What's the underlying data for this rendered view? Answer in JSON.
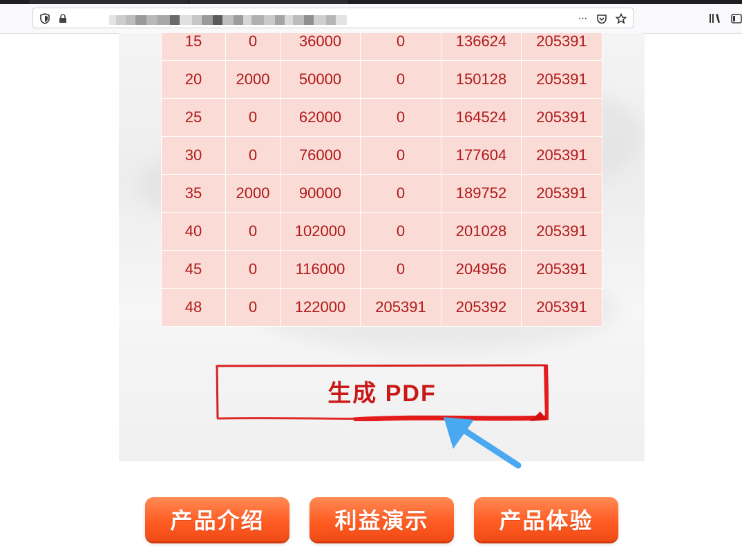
{
  "browser": {
    "url_obscured": true,
    "icons": [
      "shield-icon",
      "lock-icon",
      "more-icon",
      "pocket-icon",
      "star-icon",
      "library-icon",
      "sidebar-icon"
    ],
    "more_glyph": "···"
  },
  "table": {
    "rows": [
      [
        "15",
        "0",
        "36000",
        "0",
        "136624",
        "205391"
      ],
      [
        "20",
        "2000",
        "50000",
        "0",
        "150128",
        "205391"
      ],
      [
        "25",
        "0",
        "62000",
        "0",
        "164524",
        "205391"
      ],
      [
        "30",
        "0",
        "76000",
        "0",
        "177604",
        "205391"
      ],
      [
        "35",
        "2000",
        "90000",
        "0",
        "189752",
        "205391"
      ],
      [
        "40",
        "0",
        "102000",
        "0",
        "201028",
        "205391"
      ],
      [
        "45",
        "0",
        "116000",
        "0",
        "204956",
        "205391"
      ],
      [
        "48",
        "0",
        "122000",
        "205391",
        "205392",
        "205391"
      ]
    ]
  },
  "pdf_button": {
    "label": "生成 PDF"
  },
  "bottom_nav": {
    "product_intro": "产品介绍",
    "benefit_demo": "利益演示",
    "product_trial": "产品体验"
  },
  "colors": {
    "table_bg": "#fadbd6",
    "table_text": "#b01818",
    "accent_red": "#c81818",
    "button_orange": "#ff5d24",
    "pointer_arrow": "#4aa8f0"
  }
}
